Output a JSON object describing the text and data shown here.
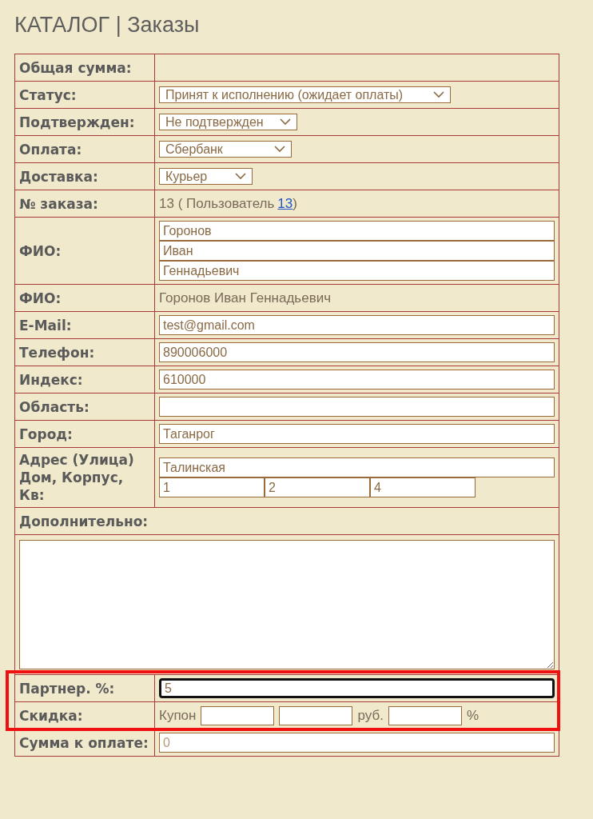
{
  "page_title": "КАТАЛОГ | Заказы",
  "rows": [
    {
      "label": "Общая сумма:",
      "kind": "empty",
      "highlighted": false
    },
    {
      "label": "Статус:",
      "kind": "select",
      "value": "Принят к исполнению (ожидает оплаты)",
      "highlighted": false
    },
    {
      "label": "Подтвержден:",
      "kind": "select",
      "value": "Не подтвержден",
      "highlighted": false
    },
    {
      "label": "Оплата:",
      "kind": "select",
      "value": "Сбербанк",
      "highlighted": false
    },
    {
      "label": "Доставка:",
      "kind": "select",
      "value": "Курьер",
      "highlighted": false
    },
    {
      "label": "№ заказа:",
      "kind": "parts",
      "highlighted": false,
      "parts": [
        {
          "kind": "text",
          "text": "13 ( Пользователь"
        },
        {
          "kind": "link",
          "text": "13"
        },
        {
          "kind": "text",
          "text": ")"
        }
      ]
    },
    {
      "label": "ФИО:",
      "kind": "stack",
      "highlighted": false,
      "fields": [
        {
          "value": "Горонов"
        },
        {
          "value": "Иван"
        },
        {
          "value": "Геннадьевич"
        }
      ]
    },
    {
      "label": "ФИО:",
      "kind": "parts",
      "highlighted": false,
      "parts": [
        {
          "kind": "text",
          "text": "Горонов Иван Геннадьевич"
        }
      ]
    },
    {
      "label": "E-Mail:",
      "kind": "input",
      "value": "test@gmail.com",
      "highlighted": false
    },
    {
      "label": "Телефон:",
      "kind": "input",
      "value": "890006000",
      "highlighted": false
    },
    {
      "label": "Индекс:",
      "kind": "input",
      "value": "610000",
      "highlighted": false
    },
    {
      "label": "Область:",
      "kind": "input",
      "highlighted": false
    },
    {
      "label": "Город:",
      "kind": "input",
      "value": "Таганрог",
      "highlighted": false
    },
    {
      "label": "Адрес (Улица) Дом, Корпус, Кв:",
      "kind": "address",
      "highlighted": false,
      "street": "Талинская",
      "fields": [
        {
          "value": "1"
        },
        {
          "value": "2"
        },
        {
          "value": "4"
        }
      ]
    },
    {
      "label": "Дополнительно:",
      "kind": "heading",
      "highlighted": false
    },
    {
      "kind": "textarea",
      "highlighted": false
    },
    {
      "label": "Партнер. %:",
      "kind": "input",
      "value": "5",
      "focused": true,
      "highlighted": true
    },
    {
      "label": "Скидка:",
      "kind": "parts",
      "highlighted": true,
      "parts": [
        {
          "kind": "text",
          "text": "Купон"
        },
        {
          "kind": "input"
        },
        {
          "kind": "input"
        },
        {
          "kind": "text",
          "text": "руб."
        },
        {
          "kind": "input"
        },
        {
          "kind": "text",
          "text": "%"
        }
      ]
    },
    {
      "label": "Сумма к оплате:",
      "kind": "input",
      "placeholder": "0",
      "highlighted": false
    }
  ]
}
